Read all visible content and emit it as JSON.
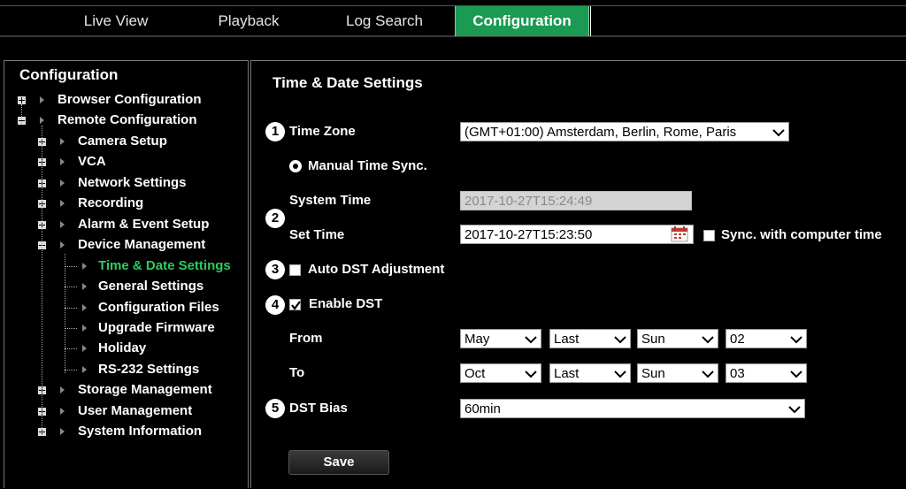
{
  "nav": {
    "tabs": [
      {
        "label": "Live View",
        "active": false
      },
      {
        "label": "Playback",
        "active": false
      },
      {
        "label": "Log Search",
        "active": false
      },
      {
        "label": "Configuration",
        "active": true
      }
    ]
  },
  "sidebar": {
    "title": "Configuration",
    "items": [
      {
        "label": "Browser Configuration",
        "expander": "plus",
        "level": 0
      },
      {
        "label": "Remote Configuration",
        "expander": "minus",
        "level": 0
      },
      {
        "label": "Camera Setup",
        "expander": "plus",
        "level": 1
      },
      {
        "label": "VCA",
        "expander": "plus",
        "level": 1
      },
      {
        "label": "Network Settings",
        "expander": "plus",
        "level": 1
      },
      {
        "label": "Recording",
        "expander": "plus",
        "level": 1
      },
      {
        "label": "Alarm & Event Setup",
        "expander": "plus",
        "level": 1
      },
      {
        "label": "Device Management",
        "expander": "minus",
        "level": 1
      },
      {
        "label": "Time & Date Settings",
        "level": 2,
        "selected": true
      },
      {
        "label": "General Settings",
        "level": 2
      },
      {
        "label": "Configuration Files",
        "level": 2
      },
      {
        "label": "Upgrade Firmware",
        "level": 2
      },
      {
        "label": "Holiday",
        "level": 2
      },
      {
        "label": "RS-232 Settings",
        "level": 2
      },
      {
        "label": "Storage Management",
        "expander": "plus",
        "level": 1
      },
      {
        "label": "User Management",
        "expander": "plus",
        "level": 1
      },
      {
        "label": "System Information",
        "expander": "plus",
        "level": 1
      }
    ]
  },
  "main": {
    "section_title": "Time & Date Settings",
    "callouts": [
      "1",
      "2",
      "3",
      "4",
      "5"
    ],
    "time_zone": {
      "label": "Time Zone",
      "value": "(GMT+01:00) Amsterdam, Berlin, Rome, Paris"
    },
    "manual_sync": {
      "label": "Manual Time Sync.",
      "selected": true
    },
    "system_time": {
      "label": "System Time",
      "value": "2017-10-27T15:24:49"
    },
    "set_time": {
      "label": "Set Time",
      "value": "2017-10-27T15:23:50"
    },
    "sync_computer": {
      "label": "Sync. with computer time",
      "checked": false
    },
    "auto_dst": {
      "label": "Auto DST Adjustment",
      "checked": false
    },
    "enable_dst": {
      "label": "Enable DST",
      "checked": true
    },
    "from": {
      "label": "From",
      "month": "May",
      "week": "Last",
      "day": "Sun",
      "hour": "02"
    },
    "to": {
      "label": "To",
      "month": "Oct",
      "week": "Last",
      "day": "Sun",
      "hour": "03"
    },
    "dst_bias": {
      "label": "DST Bias",
      "value": "60min"
    },
    "save_label": "Save"
  },
  "colors": {
    "accent": "#1a9a52",
    "selected_text": "#2ecc5f",
    "background": "#000000"
  }
}
